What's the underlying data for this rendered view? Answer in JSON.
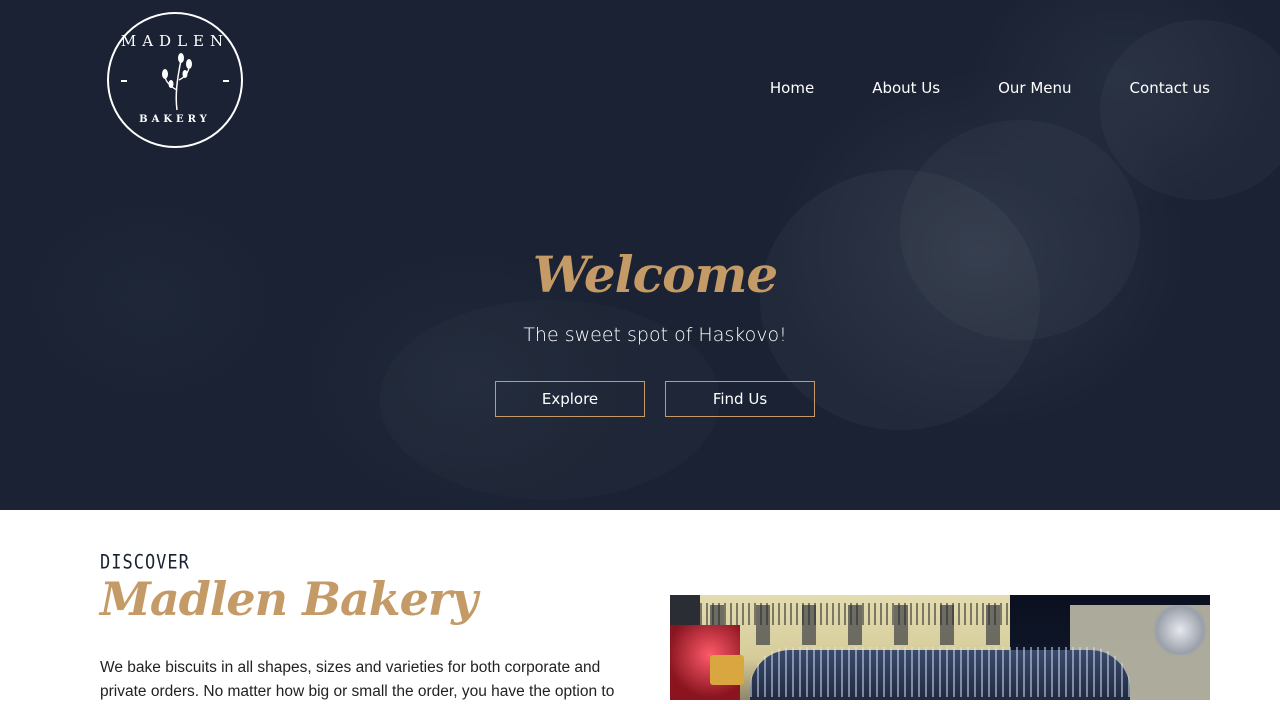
{
  "logo": {
    "top_text": "MADLEN",
    "bottom_text": "BAKERY"
  },
  "nav": {
    "items": [
      {
        "label": "Home"
      },
      {
        "label": "About Us"
      },
      {
        "label": "Our Menu"
      },
      {
        "label": "Contact us"
      }
    ]
  },
  "hero": {
    "title": "Welcome",
    "subtitle": "The sweet spot of Haskovo!",
    "buttons": {
      "explore": "Explore",
      "find": "Find Us"
    }
  },
  "discover": {
    "label": "DISCOVER",
    "title": "Madlen Bakery",
    "text": "We bake biscuits in all shapes, sizes and varieties for both corporate and private orders. No matter how big or small the order, you have the option to"
  },
  "colors": {
    "hero_background": "#1a2233",
    "accent_gold": "#c49a66",
    "text_dark": "#222222"
  }
}
